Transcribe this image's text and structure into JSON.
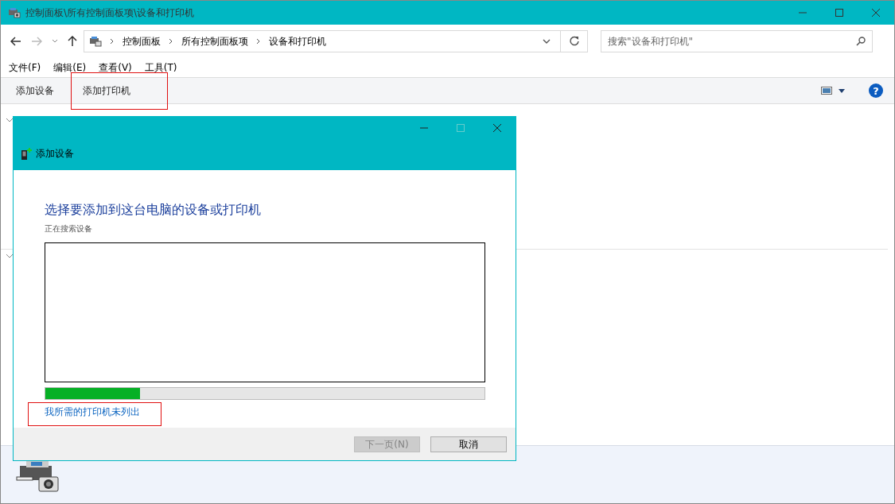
{
  "window": {
    "title": "控制面板\\所有控制面板项\\设备和打印机"
  },
  "address_bar": {
    "breadcrumbs": [
      "控制面板",
      "所有控制面板项",
      "设备和打印机"
    ]
  },
  "search": {
    "placeholder": "搜索\"设备和打印机\""
  },
  "help_glyph": "?",
  "menu": [
    "文件(F)",
    "编辑(E)",
    "查看(V)",
    "工具(T)"
  ],
  "commands": [
    {
      "label": "添加设备",
      "highlighted": false
    },
    {
      "label": "添加打印机",
      "highlighted": true
    }
  ],
  "dialog": {
    "title": "添加设备",
    "heading": "选择要添加到这台电脑的设备或打印机",
    "status": "正在搜索设备",
    "progress": {
      "level": 0.215
    },
    "link": {
      "label": "我所需的打印机未列出",
      "highlighted": true
    },
    "buttons": [
      {
        "label": "下一页(N)",
        "disabled": true
      },
      {
        "label": "取消",
        "disabled": false
      }
    ]
  }
}
